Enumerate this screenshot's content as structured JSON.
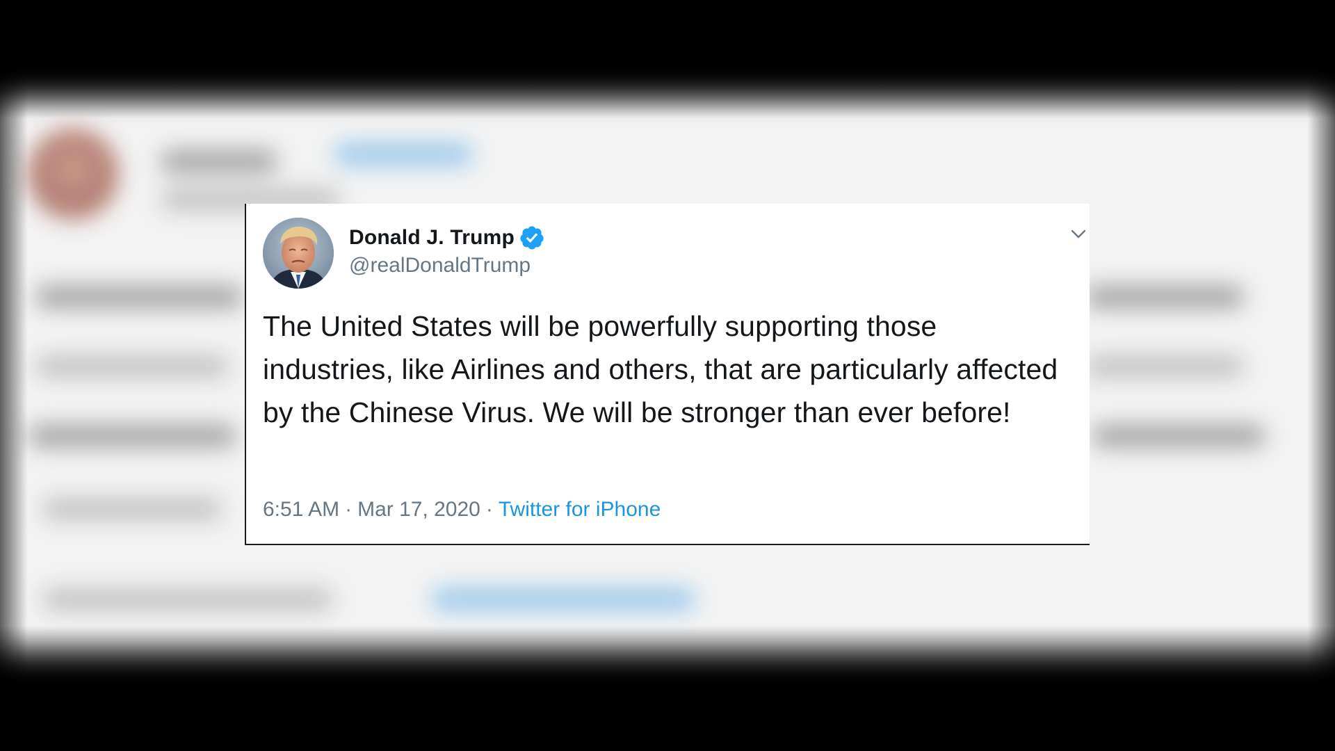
{
  "tweet": {
    "author_name": "Donald J. Trump",
    "author_handle": "@realDonaldTrump",
    "verified": true,
    "text": "The United States will be powerfully supporting those industries, like Airlines and others, that are particularly affected by the Chinese Virus. We will be stronger than ever before!",
    "time": "6:51 AM",
    "separator": "·",
    "date": "Mar 17, 2020",
    "source": "Twitter for iPhone"
  },
  "icons": {
    "verified": "verified-badge-icon",
    "menu": "chevron-down-icon"
  },
  "colors": {
    "name": "#14171a",
    "secondary_text": "#657786",
    "link": "#1b95e0",
    "verified_badge": "#1da1f2",
    "card_background": "#ffffff"
  }
}
